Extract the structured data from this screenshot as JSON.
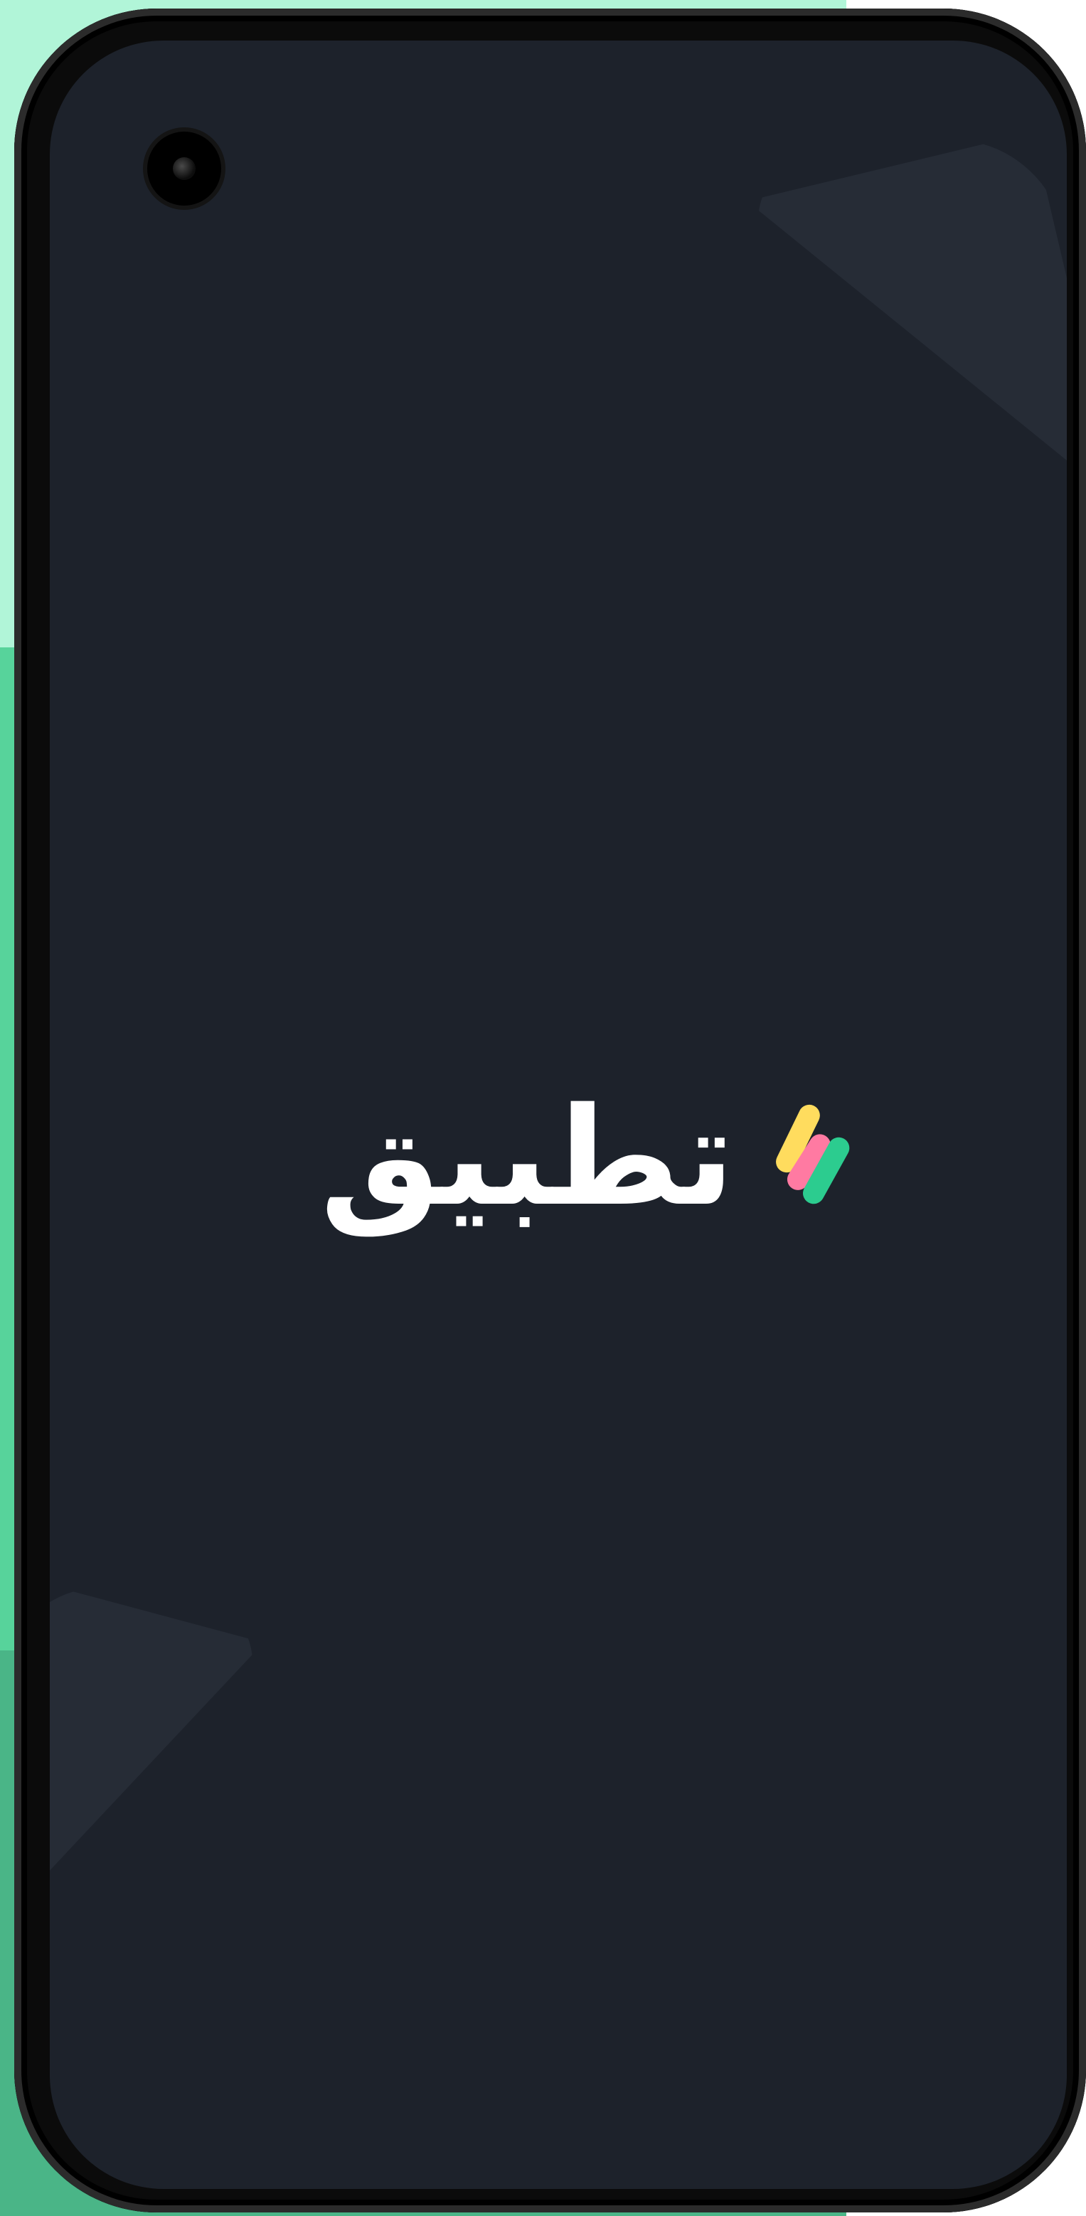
{
  "app": {
    "logo": {
      "text": "تطبيق",
      "mark_colors": [
        "#ffdc5e",
        "#ff7aa2",
        "#2ccc8f"
      ]
    }
  },
  "ui": {
    "background_color": "#1d222b"
  }
}
